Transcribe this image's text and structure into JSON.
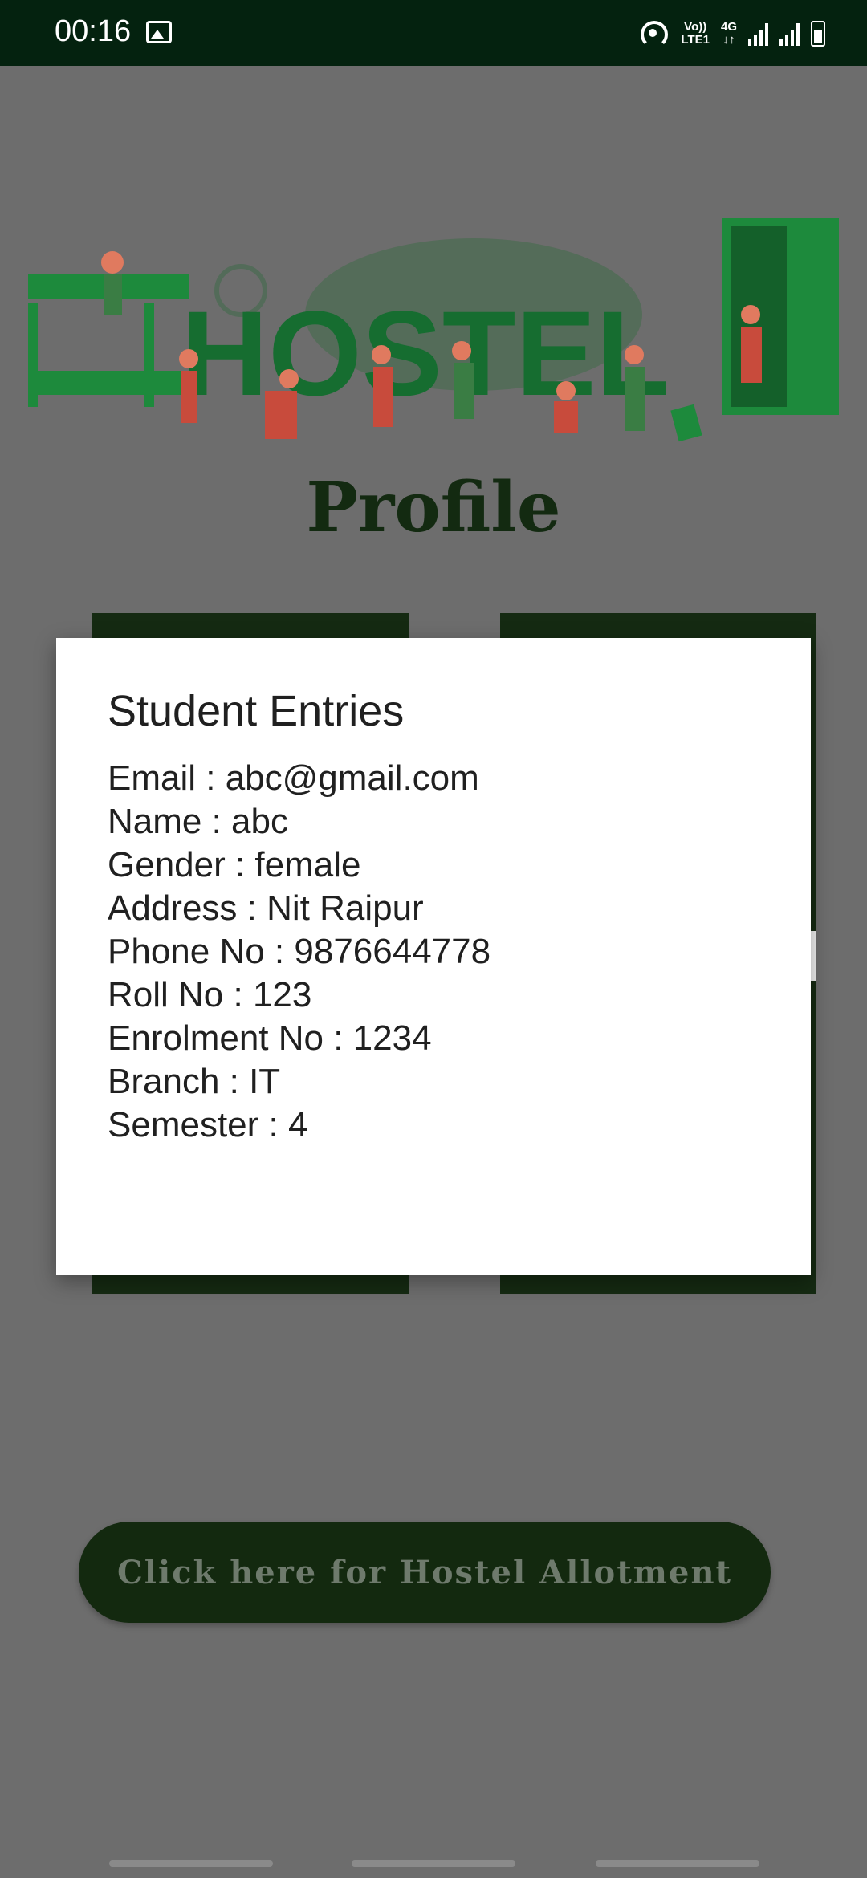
{
  "status_bar": {
    "time": "00:16",
    "volte_top": "Vo))",
    "volte_bottom": "LTE1",
    "network_type": "4G",
    "icons": [
      "image-icon",
      "hotspot-icon",
      "signal-icon",
      "battery-icon"
    ]
  },
  "header": {
    "banner_text": "HOSTEL",
    "page_title": "Profile"
  },
  "dialog": {
    "title": "Student Entries",
    "email": "Email : abc@gmail.com",
    "name": "Name : abc",
    "gender": "Gender : female",
    "address": "Address : Nit Raipur",
    "phone": "Phone No : 9876644778",
    "roll": "Roll No : 123",
    "enrolment": "Enrolment No : 1234",
    "branch": "Branch : IT",
    "semester": "Semester : 4"
  },
  "actions": {
    "allotment_button": "Click here for Hostel Allotment"
  },
  "colors": {
    "status_bar": "#04220f",
    "overlay": "#6d6d6d",
    "card": "#152a12",
    "dialog": "#ffffff"
  }
}
